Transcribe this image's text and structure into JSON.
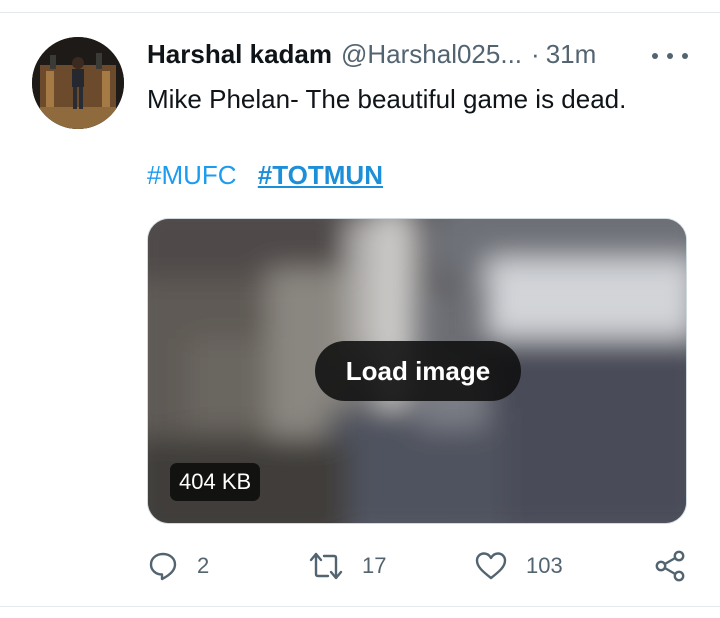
{
  "tweet": {
    "author_name": "Harshal kadam",
    "handle": "@Harshal025...",
    "separator": "·",
    "time": "31m",
    "text": "Mike Phelan- The beautiful game is dead.",
    "hashtags": [
      "#MUFC",
      "#TOTMUN"
    ]
  },
  "media": {
    "load_label": "Load image",
    "size_label": "404 KB"
  },
  "actions": {
    "reply_count": "2",
    "retweet_count": "17",
    "like_count": "103"
  },
  "icons": {
    "more": "more-horizontal-icon",
    "reply": "reply-icon",
    "retweet": "retweet-icon",
    "like": "heart-icon",
    "share": "share-icon"
  },
  "colors": {
    "hashtag": "#1d9bf0",
    "text": "#0f1419",
    "secondary": "#536471",
    "divider": "#e4e8eb"
  }
}
